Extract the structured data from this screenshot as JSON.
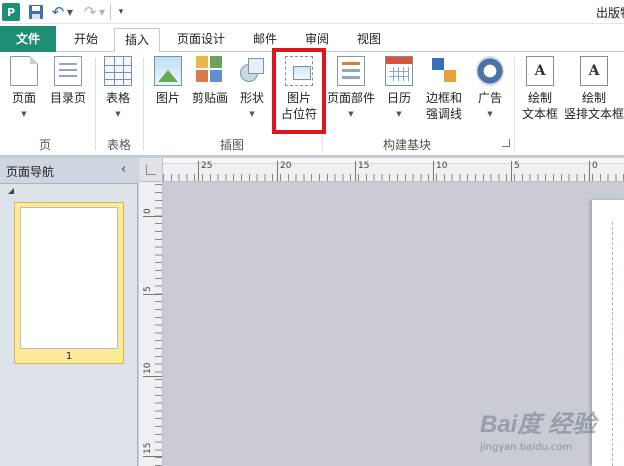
{
  "titlebar": {
    "app_icon": "P",
    "title": "出版物",
    "icons": [
      "app-icon",
      "save-icon",
      "undo-icon",
      "redo-icon",
      "customize-dropdown-icon"
    ]
  },
  "tabs": [
    {
      "label": "文件"
    },
    {
      "label": "开始"
    },
    {
      "label": "插入",
      "active": true
    },
    {
      "label": "页面设计"
    },
    {
      "label": "邮件"
    },
    {
      "label": "审阅"
    },
    {
      "label": "视图"
    }
  ],
  "ribbon": {
    "groups": [
      {
        "label": "页",
        "buttons": [
          {
            "label": "页面",
            "icon": "page-icon"
          },
          {
            "label": "目录页",
            "icon": "catalog-icon"
          }
        ]
      },
      {
        "label": "表格",
        "buttons": [
          {
            "label": "表格",
            "icon": "table-icon"
          }
        ]
      },
      {
        "label": "插图",
        "buttons": [
          {
            "label": "图片",
            "icon": "picture-icon"
          },
          {
            "label": "剪贴画",
            "icon": "clipart-icon"
          },
          {
            "label": "形状",
            "icon": "shapes-icon"
          },
          {
            "label": "图片",
            "label2": "占位符",
            "icon": "picture-placeholder-icon",
            "highlighted": true
          }
        ]
      },
      {
        "label": "构建基块",
        "buttons": [
          {
            "label": "页面部件",
            "icon": "page-parts-icon"
          },
          {
            "label": "日历",
            "icon": "calendar-icon"
          },
          {
            "label": "边框和",
            "label2": "强调线",
            "icon": "borders-icon"
          },
          {
            "label": "广告",
            "icon": "advertisement-icon"
          }
        ]
      },
      {
        "label": "",
        "buttons": [
          {
            "label": "绘制",
            "label2": "文本框",
            "icon": "textbox-icon"
          },
          {
            "label": "绘制",
            "label2": "竖排文本框",
            "icon": "vertical-textbox-icon"
          }
        ]
      }
    ],
    "textbox_glyph": "A"
  },
  "nav_pane": {
    "title": "页面导航",
    "collapse_glyph": "‹",
    "page_number": "1"
  },
  "rulers": {
    "horizontal": [
      "25",
      "20",
      "15",
      "10",
      "5",
      "0"
    ],
    "vertical": [
      "0",
      "5",
      "10",
      "15"
    ]
  },
  "colors": {
    "file_tab": "#1e8f73",
    "highlight": "#e0141e",
    "page_thumb": "#fce99a"
  },
  "watermark": {
    "brand": "Bai度 经验",
    "site": "jingyan.baidu.com"
  }
}
